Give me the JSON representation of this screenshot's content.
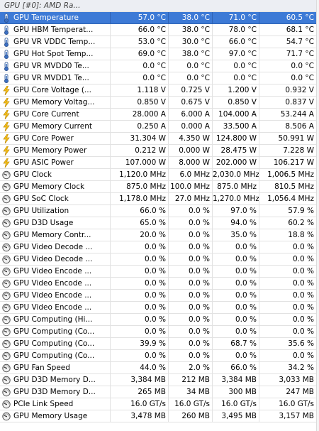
{
  "group_title": "GPU [#0]: AMD Ra...",
  "rows": [
    {
      "icon": "thermometer-icon",
      "label": "GPU Temperature",
      "current": "57.0 °C",
      "min": "38.0 °C",
      "max": "71.0 °C",
      "avg": "60.5 °C",
      "selected": true
    },
    {
      "icon": "thermometer-icon",
      "label": "GPU HBM Temperat...",
      "current": "66.0 °C",
      "min": "38.0 °C",
      "max": "78.0 °C",
      "avg": "68.1 °C"
    },
    {
      "icon": "thermometer-icon",
      "label": "GPU VR VDDC Temp...",
      "current": "53.0 °C",
      "min": "30.0 °C",
      "max": "66.0 °C",
      "avg": "54.7 °C"
    },
    {
      "icon": "thermometer-icon",
      "label": "GPU Hot Spot Temp...",
      "current": "69.0 °C",
      "min": "38.0 °C",
      "max": "97.0 °C",
      "avg": "71.7 °C"
    },
    {
      "icon": "thermometer-icon",
      "label": "GPU VR MVDD0 Te...",
      "current": "0.0 °C",
      "min": "0.0 °C",
      "max": "0.0 °C",
      "avg": "0.0 °C"
    },
    {
      "icon": "thermometer-icon",
      "label": "GPU VR MVDD1 Te...",
      "current": "0.0 °C",
      "min": "0.0 °C",
      "max": "0.0 °C",
      "avg": "0.0 °C"
    },
    {
      "icon": "lightning-icon",
      "label": "GPU Core Voltage (...",
      "current": "1.118 V",
      "min": "0.725 V",
      "max": "1.200 V",
      "avg": "0.932 V"
    },
    {
      "icon": "lightning-icon",
      "label": "GPU Memory Voltag...",
      "current": "0.850 V",
      "min": "0.675 V",
      "max": "0.850 V",
      "avg": "0.837 V"
    },
    {
      "icon": "lightning-icon",
      "label": "GPU Core Current",
      "current": "28.000 A",
      "min": "6.000 A",
      "max": "104.000 A",
      "avg": "53.244 A"
    },
    {
      "icon": "lightning-icon",
      "label": "GPU Memory Current",
      "current": "0.250 A",
      "min": "0.000 A",
      "max": "33.500 A",
      "avg": "8.506 A"
    },
    {
      "icon": "lightning-icon",
      "label": "GPU Core Power",
      "current": "31.304 W",
      "min": "4.350 W",
      "max": "124.800 W",
      "avg": "50.991 W"
    },
    {
      "icon": "lightning-icon",
      "label": "GPU Memory Power",
      "current": "0.212 W",
      "min": "0.000 W",
      "max": "28.475 W",
      "avg": "7.228 W"
    },
    {
      "icon": "lightning-icon",
      "label": "GPU ASIC Power",
      "current": "107.000 W",
      "min": "8.000 W",
      "max": "202.000 W",
      "avg": "106.217 W"
    },
    {
      "icon": "gauge-icon",
      "label": "GPU Clock",
      "current": "1,120.0 MHz",
      "min": "6.0 MHz",
      "max": "2,030.0 MHz",
      "avg": "1,006.5 MHz"
    },
    {
      "icon": "gauge-icon",
      "label": "GPU Memory Clock",
      "current": "875.0 MHz",
      "min": "100.0 MHz",
      "max": "875.0 MHz",
      "avg": "810.5 MHz"
    },
    {
      "icon": "gauge-icon",
      "label": "GPU SoC Clock",
      "current": "1,178.0 MHz",
      "min": "27.0 MHz",
      "max": "1,270.0 MHz",
      "avg": "1,056.4 MHz"
    },
    {
      "icon": "gauge-icon",
      "label": "GPU Utilization",
      "current": "66.0 %",
      "min": "0.0 %",
      "max": "97.0 %",
      "avg": "57.9 %"
    },
    {
      "icon": "gauge-icon",
      "label": "GPU D3D Usage",
      "current": "65.0 %",
      "min": "0.0 %",
      "max": "94.0 %",
      "avg": "60.2 %"
    },
    {
      "icon": "gauge-icon",
      "label": "GPU Memory Contr...",
      "current": "20.0 %",
      "min": "0.0 %",
      "max": "35.0 %",
      "avg": "18.8 %"
    },
    {
      "icon": "gauge-icon",
      "label": "GPU Video Decode ...",
      "current": "0.0 %",
      "min": "0.0 %",
      "max": "0.0 %",
      "avg": "0.0 %"
    },
    {
      "icon": "gauge-icon",
      "label": "GPU Video Decode ...",
      "current": "0.0 %",
      "min": "0.0 %",
      "max": "0.0 %",
      "avg": "0.0 %"
    },
    {
      "icon": "gauge-icon",
      "label": "GPU Video Encode ...",
      "current": "0.0 %",
      "min": "0.0 %",
      "max": "0.0 %",
      "avg": "0.0 %"
    },
    {
      "icon": "gauge-icon",
      "label": "GPU Video Encode ...",
      "current": "0.0 %",
      "min": "0.0 %",
      "max": "0.0 %",
      "avg": "0.0 %"
    },
    {
      "icon": "gauge-icon",
      "label": "GPU Video Encode ...",
      "current": "0.0 %",
      "min": "0.0 %",
      "max": "0.0 %",
      "avg": "0.0 %"
    },
    {
      "icon": "gauge-icon",
      "label": "GPU Video Encode ...",
      "current": "0.0 %",
      "min": "0.0 %",
      "max": "0.0 %",
      "avg": "0.0 %"
    },
    {
      "icon": "gauge-icon",
      "label": "GPU Computing (Hi...",
      "current": "0.0 %",
      "min": "0.0 %",
      "max": "0.0 %",
      "avg": "0.0 %"
    },
    {
      "icon": "gauge-icon",
      "label": "GPU Computing (Co...",
      "current": "0.0 %",
      "min": "0.0 %",
      "max": "0.0 %",
      "avg": "0.0 %"
    },
    {
      "icon": "gauge-icon",
      "label": "GPU Computing (Co...",
      "current": "39.9 %",
      "min": "0.0 %",
      "max": "68.7 %",
      "avg": "35.6 %"
    },
    {
      "icon": "gauge-icon",
      "label": "GPU Computing (Co...",
      "current": "0.0 %",
      "min": "0.0 %",
      "max": "0.0 %",
      "avg": "0.0 %"
    },
    {
      "icon": "gauge-icon",
      "label": "GPU Fan Speed",
      "current": "44.0 %",
      "min": "2.0 %",
      "max": "66.0 %",
      "avg": "34.2 %"
    },
    {
      "icon": "gauge-icon",
      "label": "GPU D3D Memory D...",
      "current": "3,384 MB",
      "min": "212 MB",
      "max": "3,384 MB",
      "avg": "3,033 MB"
    },
    {
      "icon": "gauge-icon",
      "label": "GPU D3D Memory D...",
      "current": "265 MB",
      "min": "34 MB",
      "max": "300 MB",
      "avg": "247 MB"
    },
    {
      "icon": "gauge-icon",
      "label": "PCIe Link Speed",
      "current": "16.0 GT/s",
      "min": "16.0 GT/s",
      "max": "16.0 GT/s",
      "avg": "16.0 GT/s"
    },
    {
      "icon": "gauge-icon",
      "label": "GPU Memory Usage",
      "current": "3,478 MB",
      "min": "260 MB",
      "max": "3,495 MB",
      "avg": "3,157 MB"
    }
  ],
  "colors": {
    "selection": "#3d7ad6",
    "header_bg": "#eceef3",
    "grid_line": "#e2e2e2"
  }
}
